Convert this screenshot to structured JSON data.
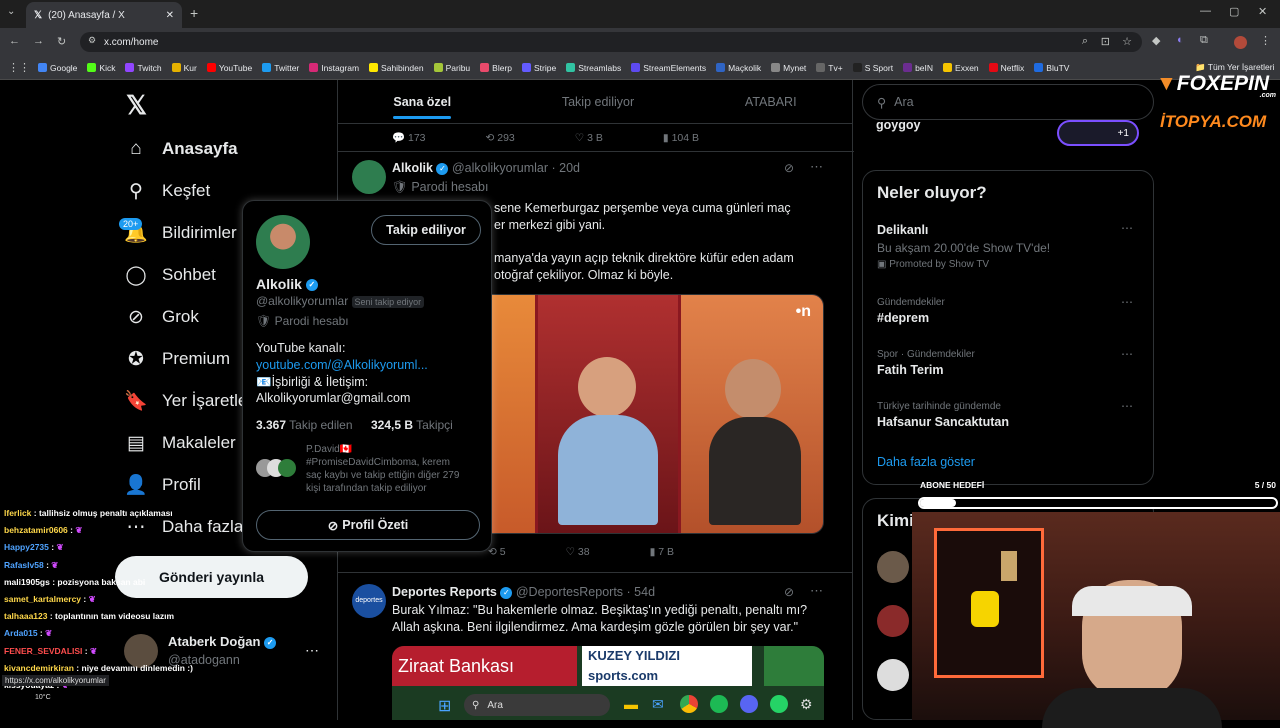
{
  "browser": {
    "tab_title": "(20) Anasayfa / X",
    "url": "x.com/home",
    "bookmarks": [
      {
        "label": "Google",
        "color": "#4285f4"
      },
      {
        "label": "Kick",
        "color": "#53fc18"
      },
      {
        "label": "Twitch",
        "color": "#9146ff"
      },
      {
        "label": "Kur",
        "color": "#e5b100"
      },
      {
        "label": "YouTube",
        "color": "#ff0000"
      },
      {
        "label": "Twitter",
        "color": "#1d9bf0"
      },
      {
        "label": "Instagram",
        "color": "#d62976"
      },
      {
        "label": "Sahibinden",
        "color": "#ffe800"
      },
      {
        "label": "Paribu",
        "color": "#a4c639"
      },
      {
        "label": "Blerp",
        "color": "#e94a6b"
      },
      {
        "label": "Stripe",
        "color": "#635bff"
      },
      {
        "label": "Streamlabs",
        "color": "#31c3a2"
      },
      {
        "label": "StreamElements",
        "color": "#5d4af0"
      },
      {
        "label": "Maçkolik",
        "color": "#2f64c4"
      },
      {
        "label": "Mynet",
        "color": "#888888"
      },
      {
        "label": "Tv+",
        "color": "#666666"
      },
      {
        "label": "S Sport",
        "color": "#222222"
      },
      {
        "label": "beIN",
        "color": "#6b2d90"
      },
      {
        "label": "Exxen",
        "color": "#f5c400"
      },
      {
        "label": "Netflix",
        "color": "#e50914"
      },
      {
        "label": "BluTV",
        "color": "#1f6be0"
      }
    ],
    "all_bookmarks": "Tüm Yer İşaretleri"
  },
  "nav": {
    "items": [
      {
        "label": "Anasayfa",
        "icon": "home-icon",
        "glyph": "⌂"
      },
      {
        "label": "Keşfet",
        "icon": "search-icon",
        "glyph": "⚲"
      },
      {
        "label": "Bildirimler",
        "icon": "bell-icon",
        "glyph": "🔔"
      },
      {
        "label": "Sohbet",
        "icon": "chat-icon",
        "glyph": "◯"
      },
      {
        "label": "Grok",
        "icon": "grok-icon",
        "glyph": "⊘"
      },
      {
        "label": "Premium",
        "icon": "premium-icon",
        "glyph": "✪"
      },
      {
        "label": "Yer İşaretleri",
        "icon": "bookmark-icon",
        "glyph": "🔖"
      },
      {
        "label": "Makaleler",
        "icon": "article-icon",
        "glyph": "▤"
      },
      {
        "label": "Profil",
        "icon": "profile-icon",
        "glyph": "👤"
      },
      {
        "label": "Daha fazla",
        "icon": "more-icon",
        "glyph": "⋯"
      }
    ],
    "notif_badge": "20+",
    "post_button": "Gönderi yayınla",
    "account": {
      "name": "Ataberk Doğan",
      "handle": "@atadogann"
    }
  },
  "feed": {
    "tabs": [
      "Sana özel",
      "Takip ediliyor",
      "ATABARI"
    ],
    "top_actions": {
      "replies": "173",
      "reposts": "293",
      "likes": "3 B",
      "views": "104 B"
    },
    "tweet1": {
      "name": "Alkolik",
      "handle": "@alkolikyorumlar",
      "time": "· 20d",
      "label": "Parodi hesabı",
      "text1": "sene Kemerburgaz perşembe veya cuma günleri maç",
      "text2": "er merkezi gibi yani.",
      "text3": "manya'da yayın açıp teknik direktöre küfür eden adam",
      "text4": "otoğraf çekiliyor. Olmaz ki böyle.",
      "media_logo": "•n",
      "actions": {
        "reposts": "5",
        "likes": "38",
        "views": "7 B"
      }
    },
    "tweet2": {
      "name": "Deportes Reports",
      "handle": "@DeportesReports",
      "time": "· 54d",
      "text": "Burak Yılmaz: \"Bu hakemlerle olmaz. Beşiktaş'ın yediği penaltı, penaltı mı? Allah aşkına. Beni ilgilendirmez. Ama kardeşim gözle görülen bir şey var.\"",
      "media_text1": "Ziraat Bankası",
      "media_text2": "KUZEY YILDIZI",
      "media_text3": "sports.com"
    }
  },
  "hovercard": {
    "follow_button": "Takip ediliyor",
    "name": "Alkolik",
    "handle": "@alkolikyorumlar",
    "follows_you": "Seni takip ediyor",
    "label": "Parodi hesabı",
    "bio1": "YouTube kanalı:",
    "bio_link": "youtube.com/@Alkolikyoruml...",
    "bio2": "📧İşbirliği & İletişim:",
    "bio3": "Alkolikyorumlar@gmail.com",
    "following_count": "3.367",
    "following_label": "Takip edilen",
    "followers_count": "324,5 B",
    "followers_label": "Takipçi",
    "mutual_line1": "P.David🇨🇦",
    "mutual_line2": "#PromiseDavidCimboma, kerem",
    "mutual_line3": "saç kaybı ve takip ettiğin diğer 279",
    "mutual_line4": "kişi tarafından takip ediliyor",
    "summary_button": "Profil Özeti"
  },
  "sidebar": {
    "search_placeholder": "Ara",
    "top_name": "goygoy",
    "top_badge": "+1",
    "trends_title": "Neler oluyor?",
    "trends": [
      {
        "cat": "",
        "title": "Delikanlı",
        "sub": "Bu akşam 20.00'de Show TV'de!",
        "promo": "Promoted by Show TV"
      },
      {
        "cat": "Gündemdekiler",
        "title": "#deprem"
      },
      {
        "cat": "Spor · Gündemdekiler",
        "title": "Fatih Terim"
      },
      {
        "cat": "Türkiye tarihinde gündemde",
        "title": "Hafsanur Sancaktutan"
      }
    ],
    "show_more": "Daha fazla göster",
    "who_to_follow": "Kimi t"
  },
  "stream": {
    "brand1": "FOXEPIN",
    "brand1_sub": ".com",
    "brand2": "İTOPYA.COM",
    "goal_label": "ABONE HEDEFİ",
    "goal_value": "5 / 50",
    "goal_fraction": 0.1,
    "chat": [
      {
        "user": "lferlick",
        "msg": "tallihsiz olmuş penaltı açıklaması",
        "color": "#ffd84a"
      },
      {
        "user": "behzatamir0606",
        "msg": "",
        "color": "#ffd84a"
      },
      {
        "user": "Happy2735",
        "msg": "",
        "color": "#4fa3ff"
      },
      {
        "user": "Rafaslv58",
        "msg": "",
        "color": "#4fa3ff"
      },
      {
        "user": "mali1905gs",
        "msg": "pozisyona baksan abi",
        "color": "#ffffff"
      },
      {
        "user": "samet_kartalmercy",
        "msg": "",
        "color": "#ffd84a"
      },
      {
        "user": "talhaaa123",
        "msg": "toplantının tam videosu lazım",
        "color": "#ffd84a"
      },
      {
        "user": "Arda015",
        "msg": "",
        "color": "#4fa3ff"
      },
      {
        "user": "FENER_SEVDALISI",
        "msg": "",
        "color": "#ff4d4d"
      },
      {
        "user": "kivancdemirkiran",
        "msg": "niye devamını dinlemedin :)",
        "color": "#ffd84a"
      },
      {
        "user": "kissyouayaz",
        "msg": "",
        "color": "#ffffff"
      }
    ],
    "status_url": "https://x.com/alkolikyorumlar"
  },
  "taskbar": {
    "search": "Ara",
    "temp": "10°C"
  }
}
